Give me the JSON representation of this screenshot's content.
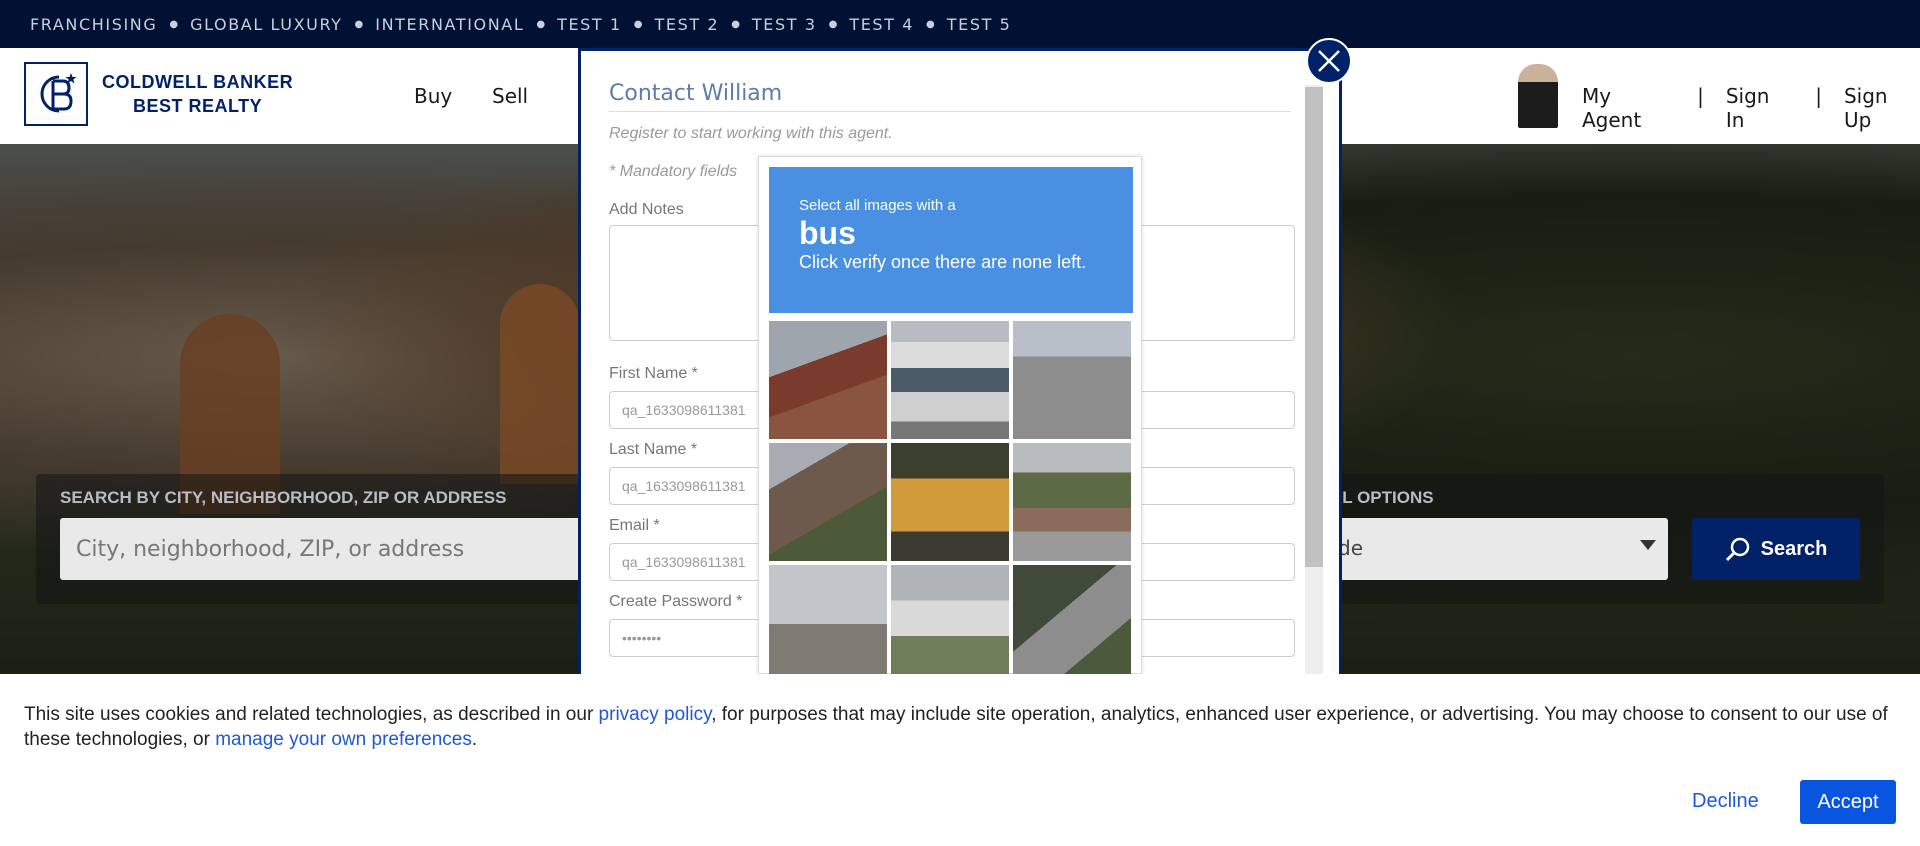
{
  "topbar": {
    "items": [
      "FRANCHISING",
      "GLOBAL LUXURY",
      "INTERNATIONAL",
      "TEST 1",
      "TEST 2",
      "TEST 3",
      "TEST 4",
      "TEST 5"
    ]
  },
  "header": {
    "logo_line1": "COLDWELL BANKER",
    "logo_line2": "BEST REALTY",
    "nav": [
      "Buy",
      "Sell"
    ],
    "agent_links": [
      "My Agent",
      "Sign In",
      "Sign Up"
    ],
    "separator": "|"
  },
  "search": {
    "label": "SEARCH BY CITY, NEIGHBORHOOD, ZIP OR ADDRESS",
    "placeholder": "City, neighborhood, ZIP, or address",
    "additional_label": "AL OPTIONS",
    "select_value": "de",
    "button_label": "Search"
  },
  "modal": {
    "title": "Contact William",
    "subtitle": "Register to start working with this agent.",
    "mandatory": "* Mandatory fields",
    "notes_label": "Add Notes",
    "first_name_label": "First Name *",
    "first_name_value": "qa_1633098611381",
    "last_name_label": "Last Name *",
    "last_name_value": "qa_1633098611381",
    "email_label": "Email *",
    "email_value": "qa_1633098611381",
    "password_label": "Create Password *",
    "password_value": "••••••••"
  },
  "captcha": {
    "line1": "Select all images with a",
    "target": "bus",
    "line3": "Click verify once there are none left.",
    "tiles": [
      "house-roof",
      "city-bus",
      "highway",
      "house-tree",
      "school-bus",
      "trees-street",
      "palm-buildings",
      "white-bus",
      "road-bushes"
    ]
  },
  "cookie": {
    "text_before": "This site uses cookies and related technologies, as described in our ",
    "link1": "privacy policy",
    "text_middle": ", for purposes that may include site operation, analytics, enhanced user experience, or advertising. You may choose to consent to our use of these technologies, or ",
    "link2": "manage your own preferences",
    "text_end": ".",
    "decline": "Decline",
    "accept": "Accept"
  },
  "colors": {
    "brand_navy": "#012169",
    "captcha_blue": "#4a90e2",
    "accept_blue": "#0a55e0"
  }
}
